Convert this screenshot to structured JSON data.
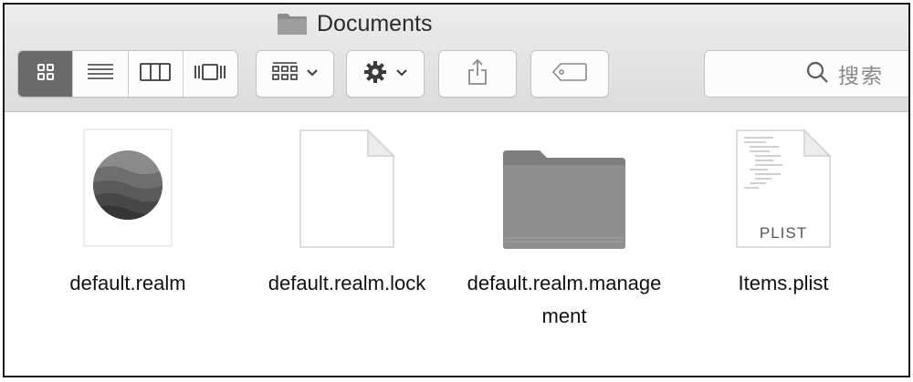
{
  "window": {
    "title": "Documents"
  },
  "toolbar": {
    "view_modes": [
      {
        "name": "icon-view",
        "active": true
      },
      {
        "name": "list-view",
        "active": false
      },
      {
        "name": "column-view",
        "active": false
      },
      {
        "name": "cover-flow-view",
        "active": false
      }
    ],
    "group_button_icon": "arrange-grid-icon",
    "action_button_icon": "gear-icon",
    "share_button_icon": "share-icon",
    "tags_button_icon": "tag-icon",
    "search_placeholder": "搜索"
  },
  "files": [
    {
      "name": "default.realm",
      "type": "realm-document"
    },
    {
      "name": "default.realm.lock",
      "type": "blank-document"
    },
    {
      "name": "default.realm.management",
      "type": "folder"
    },
    {
      "name": "Items.plist",
      "type": "plist-document",
      "badge": "PLIST"
    }
  ],
  "colors": {
    "toolbar_bg": "#e2e2e2",
    "active_segment": "#6a6a6a",
    "folder": "#8e8e8e"
  }
}
